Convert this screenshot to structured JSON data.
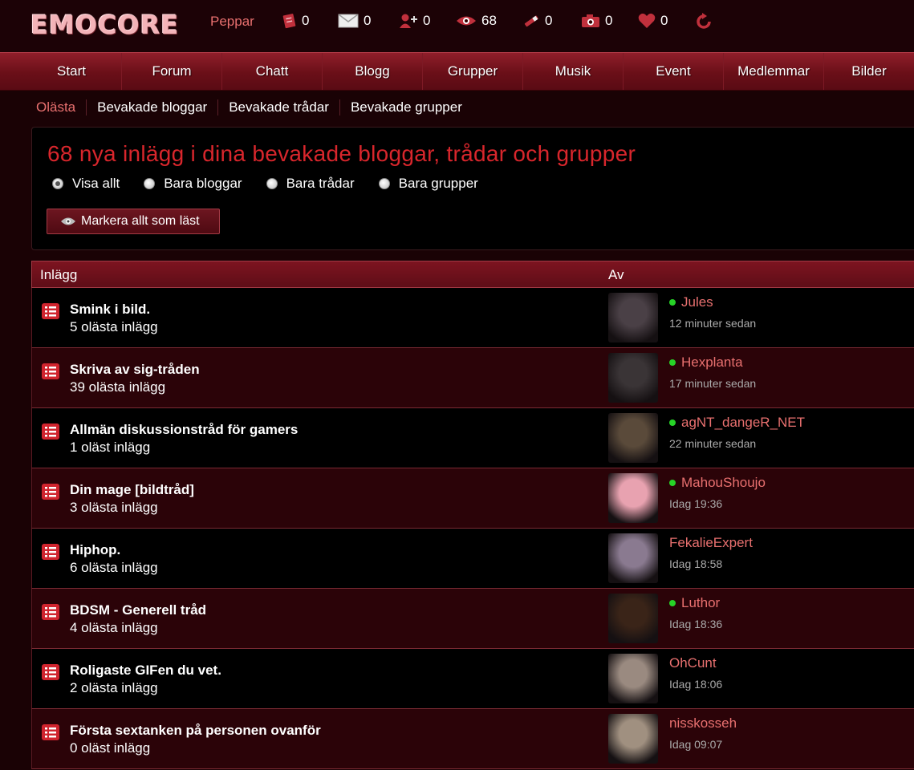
{
  "header": {
    "logo": "EMOCORE",
    "username": "Peppar",
    "stats": [
      {
        "icon": "guestbook-icon",
        "value": "0"
      },
      {
        "icon": "mail-icon",
        "value": "0"
      },
      {
        "icon": "friend-request-icon",
        "value": "0"
      },
      {
        "icon": "eye-icon",
        "value": "68"
      },
      {
        "icon": "pen-icon",
        "value": "0"
      },
      {
        "icon": "camera-icon",
        "value": "0"
      },
      {
        "icon": "heart-icon",
        "value": "0"
      }
    ]
  },
  "nav": [
    "Start",
    "Forum",
    "Chatt",
    "Blogg",
    "Grupper",
    "Musik",
    "Event",
    "Medlemmar",
    "Bilder"
  ],
  "subnav": [
    "Olästa",
    "Bevakade bloggar",
    "Bevakade trådar",
    "Bevakade grupper"
  ],
  "panel": {
    "title": "68 nya inlägg i dina bevakade bloggar, trådar och grupper",
    "filters": [
      "Visa allt",
      "Bara bloggar",
      "Bara trådar",
      "Bara grupper"
    ],
    "selected_filter": "Visa allt",
    "mark_button": "Markera allt som läst"
  },
  "table": {
    "col_post": "Inlägg",
    "col_by": "Av",
    "rows": [
      {
        "title": "Smink i bild.",
        "count": "5 olästa inlägg",
        "user": "Jules",
        "online": true,
        "time": "12 minuter sedan",
        "avatar": "#4a4046"
      },
      {
        "title": "Skriva av sig-tråden",
        "count": "39 olästa inlägg",
        "user": "Hexplanta",
        "online": true,
        "time": "17 minuter sedan",
        "avatar": "#3a3436"
      },
      {
        "title": "Allmän diskussionstråd för gamers",
        "count": "1 oläst inlägg",
        "user": "agNT_dangeR_NET",
        "online": true,
        "time": "22 minuter sedan",
        "avatar": "#5a4a3a"
      },
      {
        "title": "Din mage [bildtråd]",
        "count": "3 olästa inlägg",
        "user": "MahouShoujo",
        "online": true,
        "time": "Idag 19:36",
        "avatar": "#e8a2b0"
      },
      {
        "title": "Hiphop.",
        "count": "6 olästa inlägg",
        "user": "FekalieExpert",
        "online": false,
        "time": "Idag 18:58",
        "avatar": "#8a7a90"
      },
      {
        "title": "BDSM - Generell tråd",
        "count": "4 olästa inlägg",
        "user": "Luthor",
        "online": true,
        "time": "Idag 18:36",
        "avatar": "#3a2418"
      },
      {
        "title": "Roligaste GIFen du vet.",
        "count": "2 olästa inlägg",
        "user": "OhCunt",
        "online": false,
        "time": "Idag 18:06",
        "avatar": "#9a8a80"
      },
      {
        "title": "Första sextanken på personen ovanför",
        "count": "0 oläst inlägg",
        "user": "nisskosseh",
        "online": false,
        "time": "Idag 09:07",
        "avatar": "#a09080"
      }
    ]
  }
}
